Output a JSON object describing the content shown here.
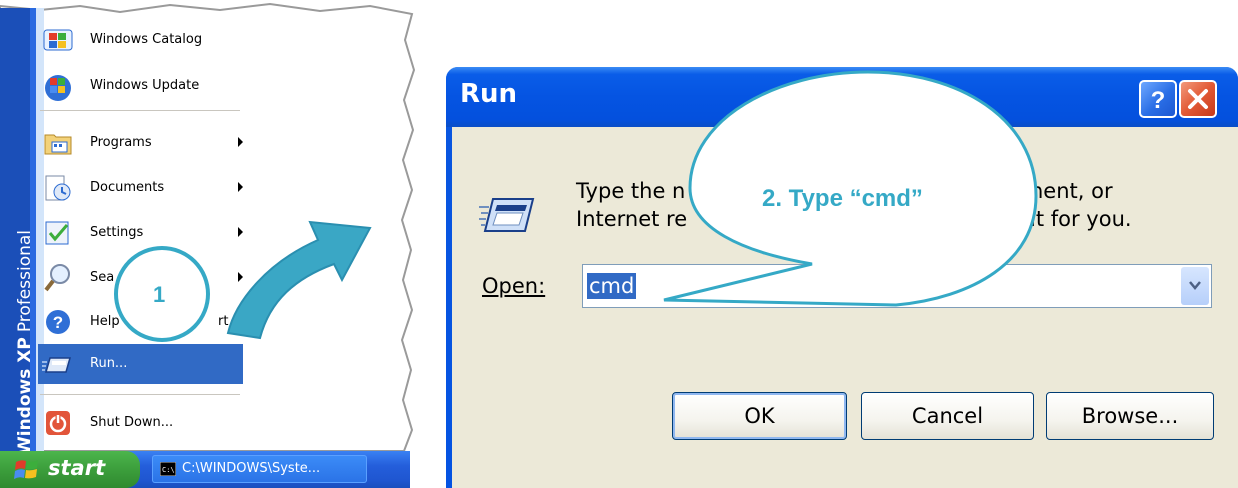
{
  "start_menu": {
    "sidebar_label_bold": "Windows XP",
    "sidebar_label_edition": "Professional",
    "items": [
      {
        "label": "Windows Catalog",
        "icon": "windows-catalog-icon"
      },
      {
        "label": "Windows Update",
        "icon": "windows-update-icon"
      },
      {
        "label": "Programs",
        "icon": "programs-icon",
        "submenu": true
      },
      {
        "label": "Documents",
        "icon": "documents-icon",
        "submenu": true
      },
      {
        "label": "Settings",
        "icon": "settings-icon",
        "submenu": true
      },
      {
        "label": "Sea",
        "icon": "search-icon",
        "submenu": true
      },
      {
        "label_left": "Help",
        "label_right": "rt",
        "icon": "help-icon"
      },
      {
        "label": "Run...",
        "icon": "run-icon",
        "highlighted": true
      },
      {
        "label": "Shut Down...",
        "icon": "shutdown-icon"
      }
    ]
  },
  "taskbar": {
    "start_label": "start",
    "task_label": "C:\\WINDOWS\\Syste..."
  },
  "run_dialog": {
    "title": "Run",
    "description_line1": "Type the n",
    "description_line1_end": "nent, or",
    "description_line2": "Internet re",
    "description_line2_end": "it for you.",
    "open_label": "Open:",
    "open_value": "cmd",
    "buttons": {
      "ok": "OK",
      "cancel": "Cancel",
      "browse": "Browse..."
    }
  },
  "annotations": {
    "step1": "1",
    "step2": "2. Type “cmd”",
    "accent_color": "#35a9c6"
  },
  "colors": {
    "xp_blue": "#0453e2",
    "menu_highlight": "#316ac5",
    "dialog_face": "#ece9d8",
    "start_green": "#3c9e3c",
    "close_red": "#e25a36"
  }
}
